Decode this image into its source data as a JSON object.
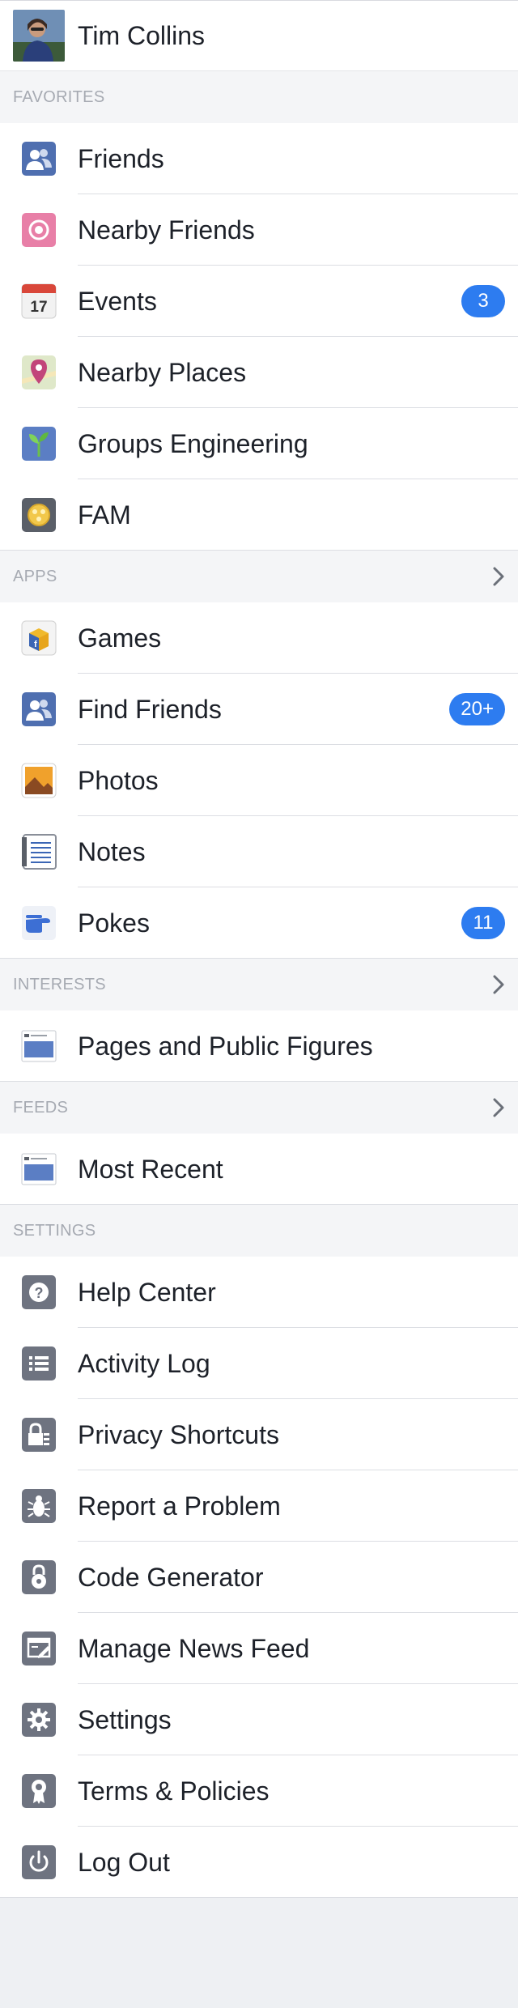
{
  "profile": {
    "name": "Tim Collins",
    "avatar_icon": "user-avatar"
  },
  "sections": [
    {
      "title": "",
      "key": "favorites-list",
      "header": {
        "title": "FAVORITES",
        "chevron": false
      },
      "items": [
        {
          "label": "Friends",
          "icon": "friends-icon",
          "badge": ""
        },
        {
          "label": "Nearby Friends",
          "icon": "nearby-friends-icon",
          "badge": ""
        },
        {
          "label": "Events",
          "icon": "calendar-icon",
          "badge": "3",
          "calendar_day": "17"
        },
        {
          "label": "Nearby Places",
          "icon": "map-pin-icon",
          "badge": ""
        },
        {
          "label": "Groups Engineering",
          "icon": "sprout-icon",
          "badge": ""
        },
        {
          "label": "FAM",
          "icon": "fam-icon",
          "badge": ""
        }
      ]
    },
    {
      "key": "apps-list",
      "header": {
        "title": "APPS",
        "chevron": true
      },
      "items": [
        {
          "label": "Games",
          "icon": "games-icon",
          "badge": ""
        },
        {
          "label": "Find Friends",
          "icon": "friends-icon",
          "badge": "20+"
        },
        {
          "label": "Photos",
          "icon": "photos-icon",
          "badge": ""
        },
        {
          "label": "Notes",
          "icon": "notes-icon",
          "badge": ""
        },
        {
          "label": "Pokes",
          "icon": "poke-icon",
          "badge": "11"
        }
      ]
    },
    {
      "key": "interests-list",
      "header": {
        "title": "INTERESTS",
        "chevron": true
      },
      "items": [
        {
          "label": "Pages and Public Figures",
          "icon": "feed-page-icon",
          "badge": ""
        }
      ]
    },
    {
      "key": "feeds-list",
      "header": {
        "title": "FEEDS",
        "chevron": true
      },
      "items": [
        {
          "label": "Most Recent",
          "icon": "feed-page-icon",
          "badge": ""
        }
      ]
    },
    {
      "key": "settings-list",
      "header": {
        "title": "SETTINGS",
        "chevron": false
      },
      "items": [
        {
          "label": "Help Center",
          "icon": "help-icon",
          "badge": ""
        },
        {
          "label": "Activity Log",
          "icon": "list-icon",
          "badge": ""
        },
        {
          "label": "Privacy Shortcuts",
          "icon": "lock-icon",
          "badge": ""
        },
        {
          "label": "Report a Problem",
          "icon": "bug-icon",
          "badge": ""
        },
        {
          "label": "Code Generator",
          "icon": "code-lock-icon",
          "badge": ""
        },
        {
          "label": "Manage News Feed",
          "icon": "manage-feed-icon",
          "badge": ""
        },
        {
          "label": "Settings",
          "icon": "gear-icon",
          "badge": ""
        },
        {
          "label": "Terms & Policies",
          "icon": "ribbon-icon",
          "badge": ""
        },
        {
          "label": "Log Out",
          "icon": "power-icon",
          "badge": ""
        }
      ]
    }
  ],
  "colors": {
    "badge": "#2d7cf0",
    "section_bg": "#f4f5f7",
    "section_text": "#a6aab2",
    "row_bg": "#ffffff"
  }
}
